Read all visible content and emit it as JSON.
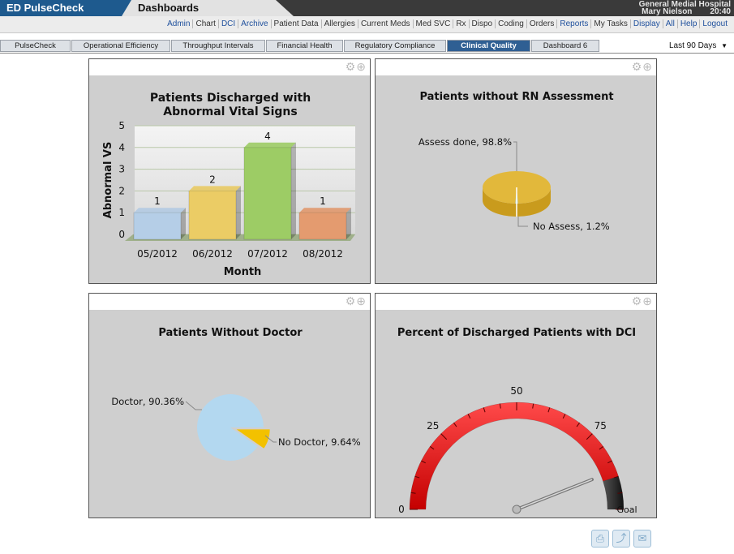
{
  "header": {
    "brand": "ED PulseCheck",
    "section": "Dashboards",
    "hospital": "General Medial Hospital",
    "user": "Mary Nielson",
    "time": "20:40"
  },
  "menu": [
    "Admin",
    "Chart",
    "DCI",
    "Archive",
    "Patient Data",
    "Allergies",
    "Current Meds",
    "Med SVC",
    "Rx",
    "Dispo",
    "Coding",
    "Orders",
    "Reports",
    "My Tasks",
    "Display",
    "All",
    "Help",
    "Logout"
  ],
  "tabs": [
    {
      "label": "PulseCheck"
    },
    {
      "label": "Operational Efficiency"
    },
    {
      "label": "Throughput Intervals"
    },
    {
      "label": "Financial Health"
    },
    {
      "label": "Regulatory Compliance"
    },
    {
      "label": "Clinical Quality"
    },
    {
      "label": "Dashboard 6"
    }
  ],
  "active_tab": "Clinical Quality",
  "period_select": "Last 90 Days",
  "panels": [
    {
      "title": "Patients Discharged with Abnormal Vital Signs"
    },
    {
      "title": "Patients without RN Assessment"
    },
    {
      "title": "Patients Without Doctor"
    },
    {
      "title": "Percent of Discharged Patients with DCI"
    }
  ],
  "chart_data": [
    {
      "type": "bar",
      "title": "Patients Discharged with Abnormal Vital Signs",
      "xlabel": "Month",
      "ylabel": "Abnormal VS",
      "categories": [
        "05/2012",
        "06/2012",
        "07/2012",
        "08/2012"
      ],
      "values": [
        1,
        2,
        4,
        1
      ],
      "value_labels": [
        "1",
        "2",
        "4",
        "1"
      ],
      "ylim": [
        0,
        5
      ],
      "yticks": [
        "0",
        "1",
        "2",
        "3",
        "4",
        "5"
      ],
      "colors": [
        "#a9c6e3",
        "#e8c44a",
        "#8cc44a",
        "#e08a56"
      ]
    },
    {
      "type": "pie",
      "title": "Patients without RN Assessment",
      "slices": [
        {
          "label": "Assess done",
          "value": 98.8,
          "text": "Assess done, 98.8%",
          "color": "#e2b83b"
        },
        {
          "label": "No Assess",
          "value": 1.2,
          "text": "No Assess, 1.2%",
          "color": "#b3d8f0"
        }
      ]
    },
    {
      "type": "pie",
      "title": "Patients Without Doctor",
      "slices": [
        {
          "label": "Doctor",
          "value": 90.36,
          "text": "Doctor, 90.36%",
          "color": "#b3d8f0"
        },
        {
          "label": "No Doctor",
          "value": 9.64,
          "text": "No Doctor, 9.64%",
          "color": "#f3c100"
        }
      ]
    },
    {
      "type": "gauge",
      "title": "Percent of Discharged Patients with DCI",
      "range": [
        0,
        100
      ],
      "tick_labels": [
        "0",
        "25",
        "50",
        "75"
      ],
      "goal_label": "Goal",
      "goal_range": [
        90,
        100
      ],
      "needle_value": 88
    }
  ],
  "footer_icons": [
    "print-icon",
    "share-icon",
    "email-icon"
  ]
}
